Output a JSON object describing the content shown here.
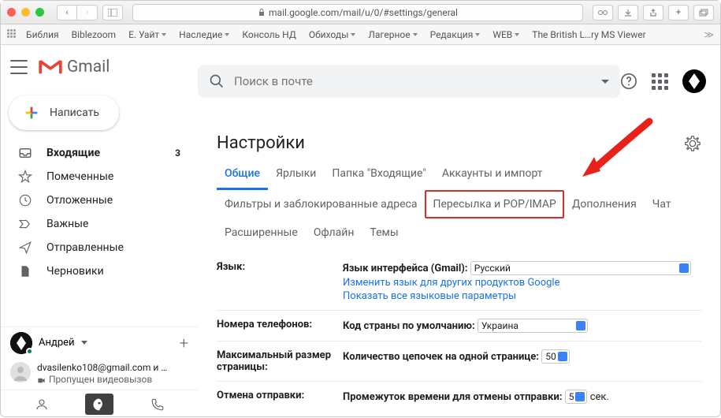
{
  "browser": {
    "url": "mail.google.com/mail/u/0/#settings/general"
  },
  "bookmarks": [
    "Библия",
    "Biblezoom",
    "Е. Уайт",
    "Наследие",
    "Консоль НД",
    "Обиходы",
    "Лагерное",
    "Редакция",
    "WEB",
    "The British L…ry MS Viewer"
  ],
  "gmail_label": "Gmail",
  "search_placeholder": "Поиск в почте",
  "compose_label": "Написать",
  "nav": [
    {
      "label": "Входящие",
      "count": "3",
      "active": true,
      "icon": "inbox"
    },
    {
      "label": "Помеченные",
      "icon": "star"
    },
    {
      "label": "Отложенные",
      "icon": "clock"
    },
    {
      "label": "Важные",
      "icon": "important"
    },
    {
      "label": "Отправленные",
      "icon": "send"
    },
    {
      "label": "Черновики",
      "icon": "draft"
    }
  ],
  "hangouts": {
    "user": "Андрей",
    "contact_email": "dvasilenko108@gmail.com и …",
    "contact_sub": "Пропущен видеовызов"
  },
  "settings": {
    "title": "Настройки",
    "tabs_row1": [
      "Общие",
      "Ярлыки",
      "Папка \"Входящие\"",
      "Аккаунты и импорт"
    ],
    "tabs_row2": [
      "Фильтры и заблокированные адреса",
      "Пересылка и POP/IMAP",
      "Дополнения",
      "Чат"
    ],
    "tabs_row3": [
      "Расширенные",
      "Офлайн",
      "Темы"
    ],
    "rows": {
      "language": {
        "label": "Язык:",
        "ui_label": "Язык интерфейса (Gmail):",
        "value": "Русский",
        "link1": "Изменить язык для других продуктов Google",
        "link2": "Показать все языковые параметры"
      },
      "phone": {
        "label": "Номера телефонов:",
        "ui_label": "Код страны по умолчанию:",
        "value": "Украина"
      },
      "pagesize": {
        "label": "Максимальный размер страницы:",
        "ui_label": "Количество цепочек на одной странице:",
        "value": "50"
      },
      "undo": {
        "label": "Отмена отправки:",
        "ui_label": "Промежуток времени для отмены отправки:",
        "value": "5",
        "suffix": "сек."
      }
    }
  }
}
